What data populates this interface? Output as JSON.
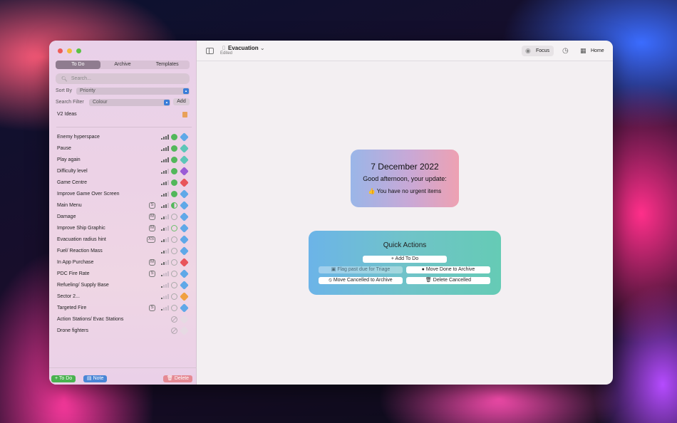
{
  "sidebar": {
    "tabs": [
      {
        "label": "To Do",
        "active": true
      },
      {
        "label": "Archive",
        "active": false
      },
      {
        "label": "Templates",
        "active": false
      }
    ],
    "search_placeholder": "Search...",
    "sort_by_label": "Sort By",
    "sort_by_value": "Priority",
    "search_filter_label": "Search Filter",
    "search_filter_value": "Colour",
    "add_label": "Add",
    "group_label": "V2 Ideas",
    "items": [
      {
        "title": "Enemy hyperspace",
        "size": "",
        "priority": 4,
        "status": "green",
        "tag": "#5fa8e8"
      },
      {
        "title": "Pause",
        "size": "",
        "priority": 4,
        "status": "green",
        "tag": "#5cc6b8"
      },
      {
        "title": "Play again",
        "size": "",
        "priority": 4,
        "status": "green",
        "tag": "#5cc6b8"
      },
      {
        "title": "Difficulty level",
        "size": "",
        "priority": 3,
        "status": "green",
        "tag": "#9b5bd6"
      },
      {
        "title": "Game Centre",
        "size": "",
        "priority": 3,
        "status": "green",
        "tag": "#e8545a"
      },
      {
        "title": "Improve Game Over Screen",
        "size": "",
        "priority": 3,
        "status": "green",
        "tag": "#5fa8e8"
      },
      {
        "title": "Main Menu",
        "size": "S",
        "priority": 3,
        "status": "half",
        "tag": "#5fa8e8"
      },
      {
        "title": "Damage",
        "size": "M",
        "priority": 2,
        "status": "open",
        "tag": "#5fa8e8"
      },
      {
        "title": "Improve Ship Graphic",
        "size": "M",
        "priority": 2,
        "status": "greenring",
        "tag": "#5fa8e8"
      },
      {
        "title": "Evacuation radius hint",
        "size": "XS",
        "priority": 2,
        "status": "open",
        "tag": "#5fa8e8"
      },
      {
        "title": "Fuel/ Reaction Mass",
        "size": "",
        "priority": 2,
        "status": "open",
        "tag": "#5fa8e8"
      },
      {
        "title": "In App Purchase",
        "size": "M",
        "priority": 2,
        "status": "open",
        "tag": "#e8545a"
      },
      {
        "title": "PDC Fire Rate",
        "size": "S",
        "priority": 1,
        "status": "open",
        "tag": "#5fa8e8"
      },
      {
        "title": "Refueling/ Supply Base",
        "size": "",
        "priority": 1,
        "status": "open",
        "tag": "#5fa8e8"
      },
      {
        "title": "Sector 2...",
        "size": "",
        "priority": 1,
        "status": "open",
        "tag": "#f0a040"
      },
      {
        "title": "Targeted Fire",
        "size": "S",
        "priority": 1,
        "status": "open",
        "tag": "#5fa8e8"
      },
      {
        "title": "Action Stations/ Evac Stations",
        "size": "",
        "priority": 0,
        "status": "blocked",
        "tag": ""
      },
      {
        "title": "Drone fighters",
        "size": "",
        "priority": 0,
        "status": "blocked",
        "tag": ""
      }
    ],
    "footer": {
      "todo_label": "To Do",
      "note_label": "Note",
      "delete_label": "Delete"
    }
  },
  "toolbar": {
    "document_title": "Evacuation",
    "document_subtitle": "Edited",
    "focus_label": "Focus",
    "home_label": "Home"
  },
  "summary_card": {
    "date": "7 December 2022",
    "greeting": "Good afternoon, your update:",
    "urgent_text": "👍 You have no urgent items"
  },
  "quick_actions": {
    "title": "Quick Actions",
    "add_todo": "Add To Do",
    "flag_past_due": "Flag past due for Triage",
    "move_done": "Move Done to Archive",
    "move_cancelled": "Move Cancelled to Archive",
    "delete_cancelled": "Delete Cancelled"
  },
  "colors": {
    "accent_green": "#49b24f",
    "accent_blue": "#4a86d6",
    "delete_red": "#e58a94"
  }
}
